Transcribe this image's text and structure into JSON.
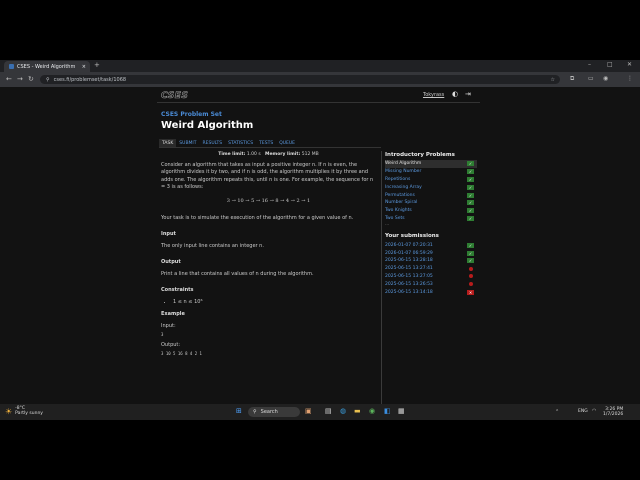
{
  "browser": {
    "tab_title": "CSES - Weird Algorithm",
    "tab_close": "×",
    "new_tab": "+",
    "url": "cses.fi/problemset/task/1068"
  },
  "site": {
    "logo": "CSES",
    "user": "Tokyrass",
    "problem_set_label": "CSES Problem Set",
    "problem_title": "Weird Algorithm",
    "tabs": [
      {
        "label": "TASK",
        "active": true
      },
      {
        "label": "SUBMIT"
      },
      {
        "label": "RESULTS"
      },
      {
        "label": "STATISTICS"
      },
      {
        "label": "TESTS"
      },
      {
        "label": "QUEUE"
      }
    ]
  },
  "task": {
    "time_limit_label": "Time limit:",
    "time_limit": "1.00 s",
    "memory_limit_label": "Memory limit:",
    "memory_limit": "512 MB",
    "intro": "Consider an algorithm that takes as input a positive integer n. If n is even, the algorithm divides it by two, and if n is odd, the algorithm multiplies it by three and adds one. The algorithm repeats this, until n is one. For example, the sequence for n = 3 is as follows:",
    "sequence": "3 → 10 → 5 → 16 → 8 → 4 → 2 → 1",
    "task_text": "Your task is to simulate the execution of the algorithm for a given value of n.",
    "input_heading": "Input",
    "input_text": "The only input line contains an integer n.",
    "output_heading": "Output",
    "output_text": "Print a line that contains all values of n during the algorithm.",
    "constraints_heading": "Constraints",
    "constraint": "1 ≤ n ≤ 10⁶",
    "example_heading": "Example",
    "input_label": "Input:",
    "input_value": "3",
    "output_label": "Output:",
    "output_value": "3 10 5 16 8 4 2 1"
  },
  "sidebar": {
    "problems_heading": "Introductory Problems",
    "problems": [
      {
        "label": "Weird Algorithm",
        "status": "ok",
        "active": true
      },
      {
        "label": "Missing Number",
        "status": "ok"
      },
      {
        "label": "Repetitions",
        "status": "ok"
      },
      {
        "label": "Increasing Array",
        "status": "ok"
      },
      {
        "label": "Permutations",
        "status": "ok"
      },
      {
        "label": "Number Spiral",
        "status": "ok"
      },
      {
        "label": "Two Knights",
        "status": "ok"
      },
      {
        "label": "Two Sets",
        "status": "ok"
      }
    ],
    "more": "...",
    "submissions_heading": "Your submissions",
    "submissions": [
      {
        "label": "2026-01-07 07:20:31",
        "status": "ok"
      },
      {
        "label": "2026-01-07 06:59:29",
        "status": "ok"
      },
      {
        "label": "2025-06-15 13:28:18",
        "status": "ok"
      },
      {
        "label": "2025-06-15 13:27:41",
        "status": "fail"
      },
      {
        "label": "2025-06-15 13:27:05",
        "status": "fail"
      },
      {
        "label": "2025-06-15 13:26:53",
        "status": "fail"
      },
      {
        "label": "2025-06-15 13:14:18",
        "status": "fail-x"
      }
    ]
  },
  "taskbar": {
    "weather_temp": "-8°C",
    "weather_desc": "Partly sunny",
    "search_label": "Search",
    "lang": "ENG",
    "time": "3:26 PM",
    "date": "1/7/2026"
  },
  "colors": {
    "link": "#5c9ae0",
    "accepted": "#2e7d32",
    "failed": "#b71c1c",
    "heading_blue": "#4a8bd6"
  }
}
